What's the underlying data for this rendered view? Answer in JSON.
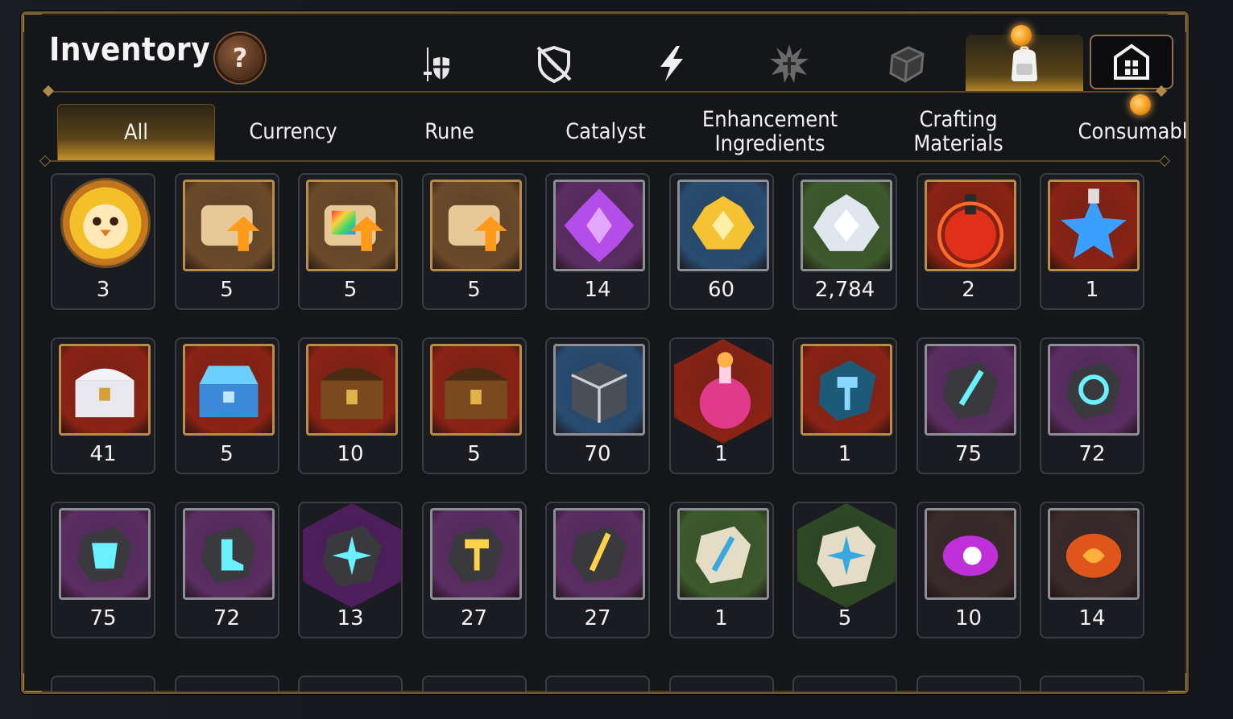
{
  "title": "Inventory",
  "help_label": "?",
  "category_tabs": [
    {
      "name": "equipment-icon",
      "active": false
    },
    {
      "name": "broken-shield-icon",
      "active": false
    },
    {
      "name": "lightning-icon",
      "active": false
    },
    {
      "name": "burst-icon",
      "active": false
    },
    {
      "name": "cube-icon",
      "active": false
    },
    {
      "name": "backpack-icon",
      "active": true,
      "badge": true
    },
    {
      "name": "castle-icon",
      "active": false
    }
  ],
  "sub_tabs": [
    {
      "label": "All",
      "active": true
    },
    {
      "label": "Currency",
      "active": false
    },
    {
      "label": "Rune",
      "active": false
    },
    {
      "label": "Catalyst",
      "active": false
    },
    {
      "label": "Enhancement Ingredients",
      "active": false
    },
    {
      "label": "Crafting Materials",
      "active": false
    },
    {
      "label": "Consumable",
      "active": false,
      "badge": true
    }
  ],
  "items": [
    {
      "icon": "chick-coin-icon",
      "count": "3",
      "bg": "#c9791d",
      "frame": "round"
    },
    {
      "icon": "scroll-up-icon",
      "count": "5",
      "bg": "#6b4a2a",
      "frame": "gold"
    },
    {
      "icon": "rainbow-scroll-icon",
      "count": "5",
      "bg": "#6b4a2a",
      "frame": "gold"
    },
    {
      "icon": "scroll-up-icon",
      "count": "5",
      "bg": "#6b4a2a",
      "frame": "gold"
    },
    {
      "icon": "purple-crystal-icon",
      "count": "14",
      "bg": "#5a2e62",
      "frame": "silver"
    },
    {
      "icon": "gold-crystal-icon",
      "count": "60",
      "bg": "#284c70",
      "frame": "blue"
    },
    {
      "icon": "silver-crystal-icon",
      "count": "2,784",
      "bg": "#3d5a2c",
      "frame": "green"
    },
    {
      "icon": "red-potion-icon",
      "count": "2",
      "bg": "#8a2315",
      "frame": "gold"
    },
    {
      "icon": "star-potion-icon",
      "count": "1",
      "bg": "#8a2315",
      "frame": "gold"
    },
    {
      "icon": "white-chest-icon",
      "count": "41",
      "bg": "#8a2315",
      "frame": "gold"
    },
    {
      "icon": "blue-chest-icon",
      "count": "5",
      "bg": "#8a2315",
      "frame": "gold"
    },
    {
      "icon": "wooden-chest-icon",
      "count": "10",
      "bg": "#8a2315",
      "frame": "gold"
    },
    {
      "icon": "wooden-chest-icon",
      "count": "5",
      "bg": "#8a2315",
      "frame": "gold"
    },
    {
      "icon": "dark-chest-icon",
      "count": "70",
      "bg": "#284c70",
      "frame": "blue"
    },
    {
      "icon": "pink-potion-icon",
      "count": "1",
      "bg": "#8a2315",
      "frame": "hex"
    },
    {
      "icon": "hammer-rune-icon",
      "count": "1",
      "bg": "#8a2315",
      "frame": "gold"
    },
    {
      "icon": "sword-rune-icon",
      "count": "75",
      "bg": "#5a2e62",
      "frame": "silver"
    },
    {
      "icon": "swirl-rune-icon",
      "count": "72",
      "bg": "#5a2e62",
      "frame": "silver"
    },
    {
      "icon": "armor-rune-icon",
      "count": "75",
      "bg": "#5a2e62",
      "frame": "silver"
    },
    {
      "icon": "boot-rune-icon",
      "count": "72",
      "bg": "#5a2e62",
      "frame": "silver"
    },
    {
      "icon": "star-rune-icon",
      "count": "13",
      "bg": "#4e1f5e",
      "frame": "hex"
    },
    {
      "icon": "gold-hammer-rune-icon",
      "count": "27",
      "bg": "#5a2e62",
      "frame": "silver"
    },
    {
      "icon": "gold-sword-rune-icon",
      "count": "27",
      "bg": "#5a2e62",
      "frame": "silver"
    },
    {
      "icon": "stone-sword-rune-icon",
      "count": "1",
      "bg": "#3d5a2c",
      "frame": "green"
    },
    {
      "icon": "stone-star-rune-icon",
      "count": "5",
      "bg": "#2e4a24",
      "frame": "hex"
    },
    {
      "icon": "purple-gem-icon",
      "count": "10",
      "bg": "#3a2a2a",
      "frame": "dark"
    },
    {
      "icon": "orange-gem-icon",
      "count": "14",
      "bg": "#3a2a2a",
      "frame": "dark"
    }
  ],
  "colors": {
    "panel_border": "#6e5630",
    "accent_gold": "#c8952c",
    "badge_orange": "#f39a19"
  }
}
